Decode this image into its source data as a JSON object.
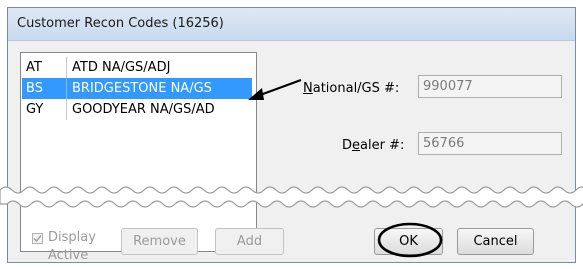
{
  "window": {
    "title": "Customer Recon Codes (16256)"
  },
  "list": {
    "rows": [
      {
        "code": "AT",
        "name": "ATD NA/GS/ADJ"
      },
      {
        "code": "BS",
        "name": "BRIDGESTONE NA/GS"
      },
      {
        "code": "GY",
        "name": "GOODYEAR NA/GS/AD"
      }
    ],
    "selected_index": 1
  },
  "fields": {
    "national_gs": {
      "label_prefix": "N",
      "label_rest": "ational/GS #:",
      "value": "990077"
    },
    "dealer": {
      "label_prefix": "D",
      "label_ul": "e",
      "label_rest": "aler #:",
      "value": "56766"
    }
  },
  "footer": {
    "display_active_label_line1": "Display",
    "display_active_label_line2": "Active",
    "display_active_checked": true,
    "remove_label": "Remove",
    "add_label": "Add",
    "ok_label": "OK",
    "cancel_label": "Cancel"
  },
  "colors": {
    "selection": "#3399ff",
    "callout": "#000000"
  }
}
